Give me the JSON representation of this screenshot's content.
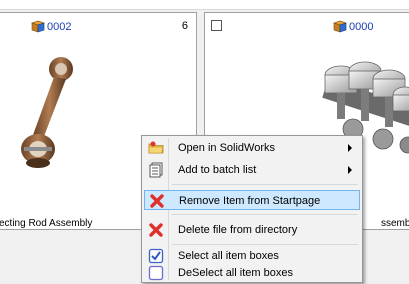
{
  "cards": [
    {
      "id": "0002",
      "count": "6",
      "name": "ecting Rod Assembly"
    },
    {
      "id": "0000",
      "count": "",
      "name": "ssembly"
    }
  ],
  "menu": {
    "items": [
      {
        "label": "Open in SolidWorks",
        "icon": "folder-icon",
        "submenu": true
      },
      {
        "label": "Add to batch list",
        "icon": "batch-list-icon",
        "submenu": true
      },
      {
        "label": "Remove Item from Startpage",
        "icon": "red-x-icon",
        "highlighted": true
      },
      {
        "label": "Delete file from directory",
        "icon": "red-x-icon"
      },
      {
        "label": "Select all item boxes",
        "icon": "checked-box-icon"
      },
      {
        "label": "DeSelect all item boxes",
        "icon": "unchecked-box-icon"
      }
    ]
  },
  "colors": {
    "highlight": "#cde8ff",
    "highlight_border": "#6fb6f0",
    "id_text": "#1a3fb0"
  }
}
